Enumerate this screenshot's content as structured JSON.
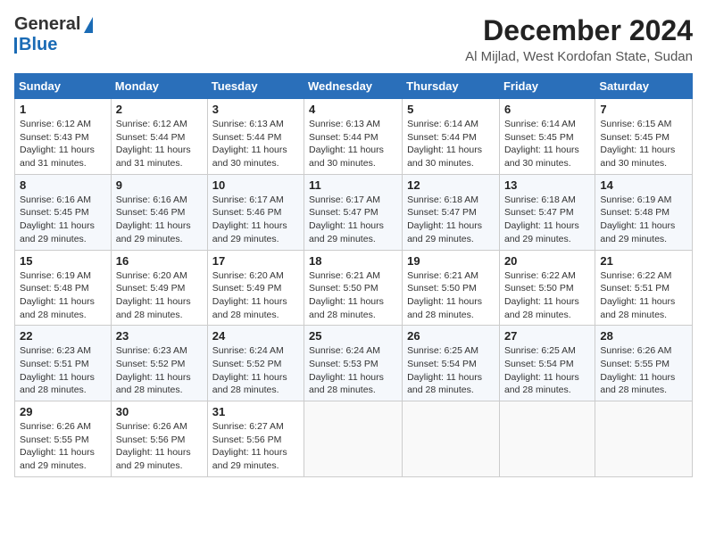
{
  "header": {
    "logo_line1": "General",
    "logo_line2": "Blue",
    "month_title": "December 2024",
    "location": "Al Mijlad, West Kordofan State, Sudan"
  },
  "days_of_week": [
    "Sunday",
    "Monday",
    "Tuesday",
    "Wednesday",
    "Thursday",
    "Friday",
    "Saturday"
  ],
  "weeks": [
    [
      {
        "day": "1",
        "sunrise": "6:12 AM",
        "sunset": "5:43 PM",
        "daylight": "11 hours and 31 minutes."
      },
      {
        "day": "2",
        "sunrise": "6:12 AM",
        "sunset": "5:44 PM",
        "daylight": "11 hours and 31 minutes."
      },
      {
        "day": "3",
        "sunrise": "6:13 AM",
        "sunset": "5:44 PM",
        "daylight": "11 hours and 30 minutes."
      },
      {
        "day": "4",
        "sunrise": "6:13 AM",
        "sunset": "5:44 PM",
        "daylight": "11 hours and 30 minutes."
      },
      {
        "day": "5",
        "sunrise": "6:14 AM",
        "sunset": "5:44 PM",
        "daylight": "11 hours and 30 minutes."
      },
      {
        "day": "6",
        "sunrise": "6:14 AM",
        "sunset": "5:45 PM",
        "daylight": "11 hours and 30 minutes."
      },
      {
        "day": "7",
        "sunrise": "6:15 AM",
        "sunset": "5:45 PM",
        "daylight": "11 hours and 30 minutes."
      }
    ],
    [
      {
        "day": "8",
        "sunrise": "6:16 AM",
        "sunset": "5:45 PM",
        "daylight": "11 hours and 29 minutes."
      },
      {
        "day": "9",
        "sunrise": "6:16 AM",
        "sunset": "5:46 PM",
        "daylight": "11 hours and 29 minutes."
      },
      {
        "day": "10",
        "sunrise": "6:17 AM",
        "sunset": "5:46 PM",
        "daylight": "11 hours and 29 minutes."
      },
      {
        "day": "11",
        "sunrise": "6:17 AM",
        "sunset": "5:47 PM",
        "daylight": "11 hours and 29 minutes."
      },
      {
        "day": "12",
        "sunrise": "6:18 AM",
        "sunset": "5:47 PM",
        "daylight": "11 hours and 29 minutes."
      },
      {
        "day": "13",
        "sunrise": "6:18 AM",
        "sunset": "5:47 PM",
        "daylight": "11 hours and 29 minutes."
      },
      {
        "day": "14",
        "sunrise": "6:19 AM",
        "sunset": "5:48 PM",
        "daylight": "11 hours and 29 minutes."
      }
    ],
    [
      {
        "day": "15",
        "sunrise": "6:19 AM",
        "sunset": "5:48 PM",
        "daylight": "11 hours and 28 minutes."
      },
      {
        "day": "16",
        "sunrise": "6:20 AM",
        "sunset": "5:49 PM",
        "daylight": "11 hours and 28 minutes."
      },
      {
        "day": "17",
        "sunrise": "6:20 AM",
        "sunset": "5:49 PM",
        "daylight": "11 hours and 28 minutes."
      },
      {
        "day": "18",
        "sunrise": "6:21 AM",
        "sunset": "5:50 PM",
        "daylight": "11 hours and 28 minutes."
      },
      {
        "day": "19",
        "sunrise": "6:21 AM",
        "sunset": "5:50 PM",
        "daylight": "11 hours and 28 minutes."
      },
      {
        "day": "20",
        "sunrise": "6:22 AM",
        "sunset": "5:50 PM",
        "daylight": "11 hours and 28 minutes."
      },
      {
        "day": "21",
        "sunrise": "6:22 AM",
        "sunset": "5:51 PM",
        "daylight": "11 hours and 28 minutes."
      }
    ],
    [
      {
        "day": "22",
        "sunrise": "6:23 AM",
        "sunset": "5:51 PM",
        "daylight": "11 hours and 28 minutes."
      },
      {
        "day": "23",
        "sunrise": "6:23 AM",
        "sunset": "5:52 PM",
        "daylight": "11 hours and 28 minutes."
      },
      {
        "day": "24",
        "sunrise": "6:24 AM",
        "sunset": "5:52 PM",
        "daylight": "11 hours and 28 minutes."
      },
      {
        "day": "25",
        "sunrise": "6:24 AM",
        "sunset": "5:53 PM",
        "daylight": "11 hours and 28 minutes."
      },
      {
        "day": "26",
        "sunrise": "6:25 AM",
        "sunset": "5:54 PM",
        "daylight": "11 hours and 28 minutes."
      },
      {
        "day": "27",
        "sunrise": "6:25 AM",
        "sunset": "5:54 PM",
        "daylight": "11 hours and 28 minutes."
      },
      {
        "day": "28",
        "sunrise": "6:26 AM",
        "sunset": "5:55 PM",
        "daylight": "11 hours and 28 minutes."
      }
    ],
    [
      {
        "day": "29",
        "sunrise": "6:26 AM",
        "sunset": "5:55 PM",
        "daylight": "11 hours and 29 minutes."
      },
      {
        "day": "30",
        "sunrise": "6:26 AM",
        "sunset": "5:56 PM",
        "daylight": "11 hours and 29 minutes."
      },
      {
        "day": "31",
        "sunrise": "6:27 AM",
        "sunset": "5:56 PM",
        "daylight": "11 hours and 29 minutes."
      },
      null,
      null,
      null,
      null
    ]
  ]
}
